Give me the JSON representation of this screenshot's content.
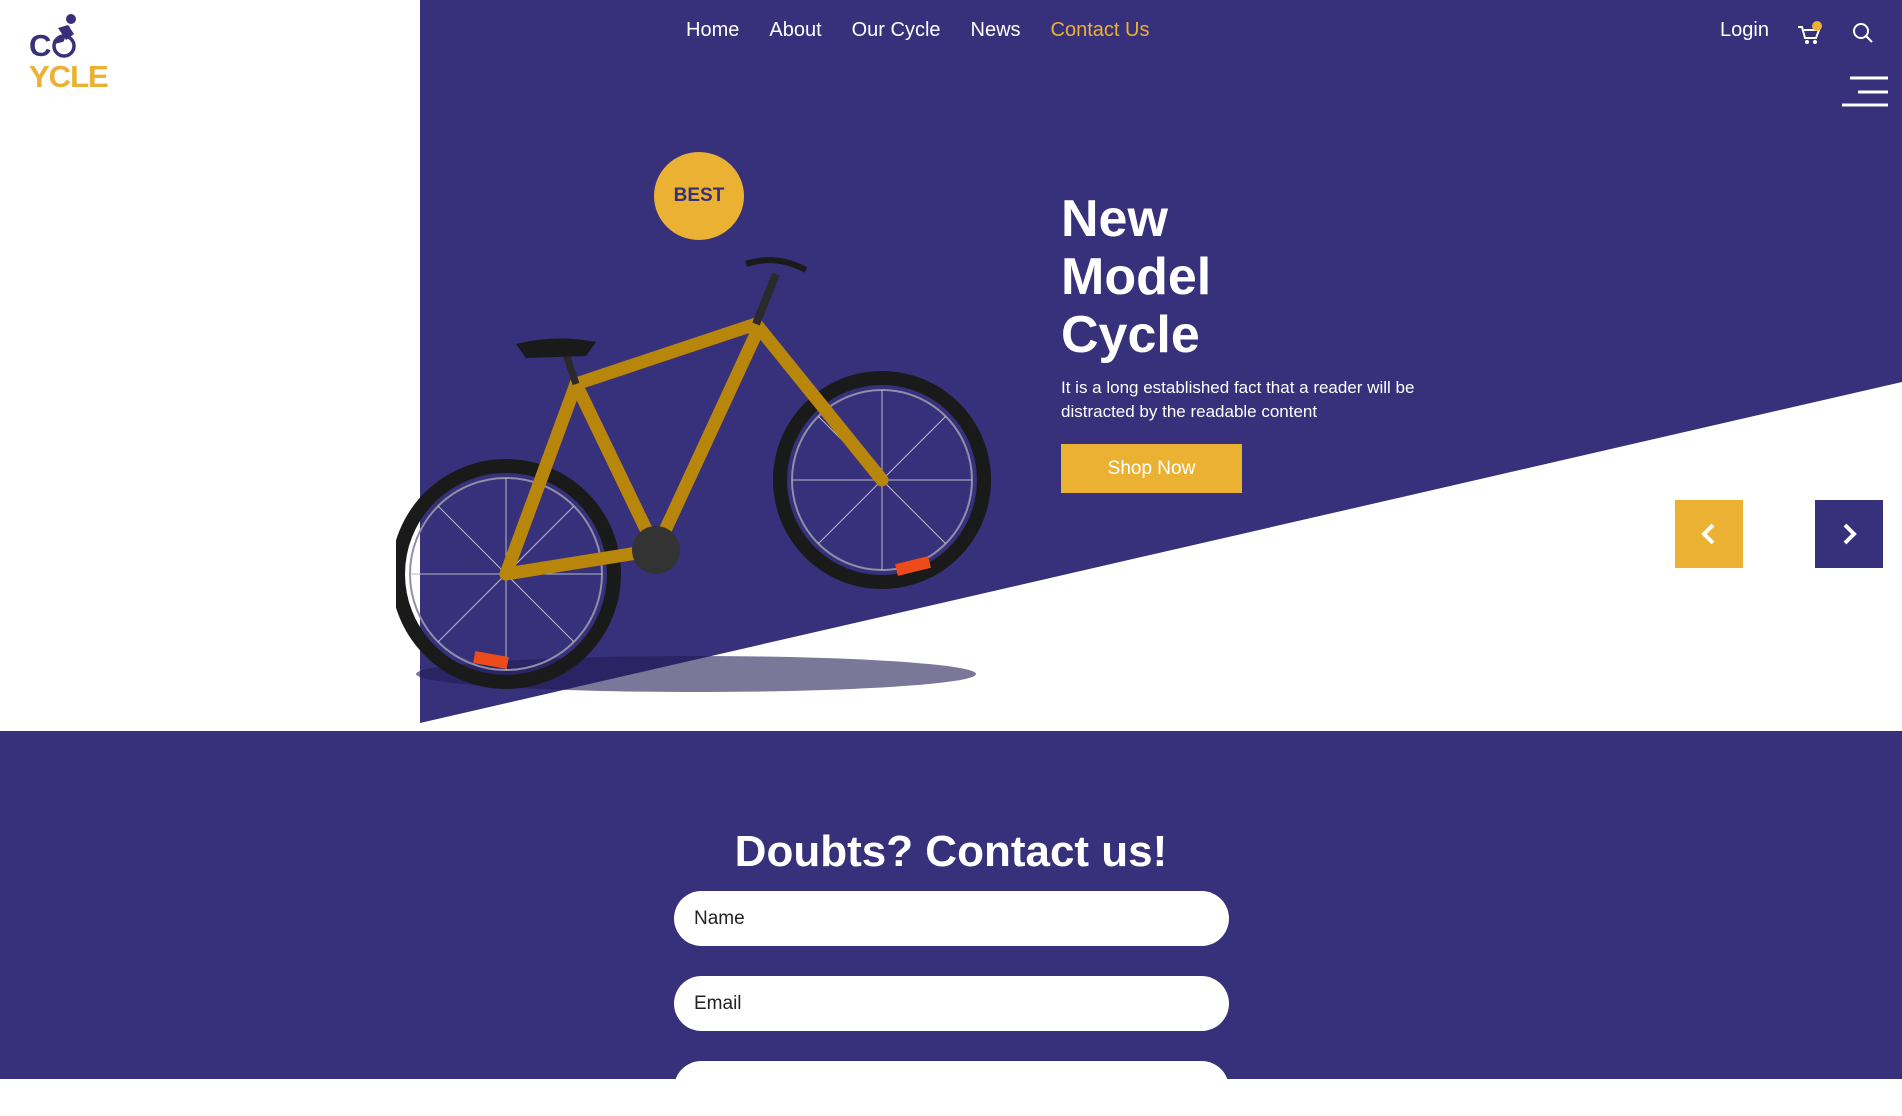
{
  "brand": {
    "logo_text_first": "C",
    "logo_text_rest": "YCLE",
    "primary_color": "#37307a",
    "accent_color": "#eab133"
  },
  "nav": {
    "items": [
      {
        "label": "Home",
        "active": false
      },
      {
        "label": "About",
        "active": false
      },
      {
        "label": "Our Cycle",
        "active": false
      },
      {
        "label": "News",
        "active": false
      },
      {
        "label": "Contact Us",
        "active": true
      }
    ],
    "login_label": "Login",
    "icons": [
      "cart-icon",
      "search-icon",
      "menu-icon"
    ]
  },
  "hero": {
    "badge": "BEST",
    "title_lines": [
      "New",
      "Model",
      "Cycle"
    ],
    "description": "It is a long established fact that a reader will be distracted by the readable content",
    "cta_label": "Shop Now",
    "slider_icons": [
      "chevron-left-icon",
      "chevron-right-icon"
    ]
  },
  "contact": {
    "title": "Doubts? Contact us!",
    "name_placeholder": "Name",
    "email_placeholder": "Email"
  }
}
